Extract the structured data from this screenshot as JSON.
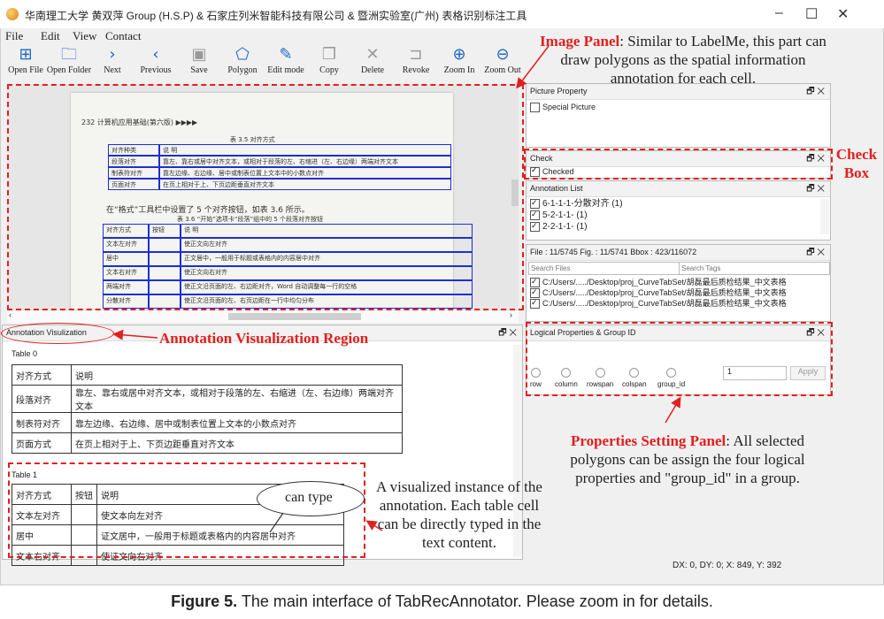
{
  "window": {
    "title": "华南理工大学 黄双萍 Group (H.S.P) & 石家庄列米智能科技有限公司 & 暨洲实验室(广州) 表格识别标注工具",
    "controls": {
      "minimize": "–",
      "maximize": "☐",
      "close": "✕"
    }
  },
  "menu": [
    "File",
    "Edit",
    "View",
    "Contact"
  ],
  "toolbar": [
    {
      "label": "Open File",
      "icon": "plus-file-icon",
      "glyph": "⊞"
    },
    {
      "label": "Open Folder",
      "icon": "folder-icon",
      "glyph": "🗀"
    },
    {
      "label": "Next",
      "icon": "chevron-right-icon",
      "glyph": "›"
    },
    {
      "label": "Previous",
      "icon": "chevron-left-icon",
      "glyph": "‹"
    },
    {
      "label": "Save",
      "icon": "save-icon",
      "glyph": "▣"
    },
    {
      "label": "Polygon",
      "icon": "polygon-icon",
      "glyph": "⬠"
    },
    {
      "label": "Edit mode",
      "icon": "edit-icon",
      "glyph": "✎"
    },
    {
      "label": "Copy",
      "icon": "copy-icon",
      "glyph": "❐"
    },
    {
      "label": "Delete",
      "icon": "delete-icon",
      "glyph": "✕"
    },
    {
      "label": "Revoke",
      "icon": "revoke-icon",
      "glyph": "⊐"
    },
    {
      "label": "Zoom In",
      "icon": "zoom-in-icon",
      "glyph": "⊕"
    },
    {
      "label": "Zoom Out",
      "icon": "zoom-out-icon",
      "glyph": "⊖"
    }
  ],
  "image_panel": {
    "page_header": "232  计算机应用基础(第六版)  ▶▶▶▶",
    "table1_caption": "表 3.5  对齐方式",
    "table1_rows": [
      [
        "对齐种类",
        "说    明"
      ],
      [
        "段落对齐",
        "靠左、靠右或居中对齐文本，或相对于段落的左、右缩进（左、右边缘）两端对齐文本"
      ],
      [
        "制表符对齐",
        "靠左边缘、右边缘、居中或制表位置上文本中的小数点对齐"
      ],
      [
        "页面对齐",
        "在页上相对于上、下页边距垂直对齐文本"
      ]
    ],
    "para_text": "在“格式”工具栏中设置了 5 个对齐按钮，如表 3.6 所示。",
    "table2_caption": "表 3.6  “开始”选项卡“段落”组中的 5 个段落对齐按钮",
    "table2_rows": [
      [
        "对齐方式",
        "按钮",
        "说    明"
      ],
      [
        "文本左对齐",
        "",
        "使正文向左对齐"
      ],
      [
        "居中",
        "",
        "正文居中，一般用于标题或表格内的内容居中对齐"
      ],
      [
        "文本右对齐",
        "",
        "使正文向右对齐"
      ],
      [
        "两端对齐",
        "",
        "使正文沿页面的左、右边距对齐，Word 自动调整每一行的空格"
      ],
      [
        "分散对齐",
        "",
        "使正文沿页面的左、右页边距在一行中均匀分布"
      ]
    ]
  },
  "docks": {
    "picture_property": {
      "title": "Picture Property",
      "checkbox": "Special Picture",
      "checked": false
    },
    "check": {
      "title": "Check",
      "checkbox": "Checked",
      "checked": true
    },
    "annotation_list": {
      "title": "Annotation List",
      "items": [
        "6-1-1-1-分散对齐 (1)",
        "5-2-1-1- (1)",
        "2-2-1-1- (1)"
      ]
    },
    "file_info": {
      "title": "File : 11/5745  Fig. : 11/5741 Bbox : 423/116072",
      "search_files_placeholder": "Search Files",
      "search_tags_placeholder": "Search Tags",
      "files": [
        "C:/Users/...../Desktop/proj_CurveTabSet/胡磊最后质检结果_中文表格",
        "C:/Users/...../Desktop/proj_CurveTabSet/胡磊最后质检结果_中文表格",
        "C:/Users/...../Desktop/proj_CurveTabSet/胡磊最后质检结果_中文表格"
      ]
    },
    "logical": {
      "title": "Logical Properties & Group ID",
      "radios": [
        "row",
        "column",
        "rowspan",
        "colspan",
        "group_id"
      ],
      "value": "1",
      "apply": "Apply"
    },
    "visualization": {
      "title": "Annotation Visulization"
    }
  },
  "visualization": {
    "table0_label": "Table 0",
    "table0": [
      [
        "对齐方式",
        "说明"
      ],
      [
        "段落对齐",
        "靠左、靠右或居中对齐文本，或相对于段落的左、右缩进（左、右边缘）两端对齐文本"
      ],
      [
        "制表符对齐",
        "靠左边缘、右边缘、居中或制表位置上文本的小数点对齐"
      ],
      [
        "页面方式",
        "在页上相对于上、下页边距垂直对齐文本"
      ]
    ],
    "table1_label": "Table 1",
    "table1": [
      [
        "对齐方式",
        "按钮",
        "说明"
      ],
      [
        "文本左对齐",
        "",
        "使文本向左对齐"
      ],
      [
        "居中",
        "",
        "证文居中，一般用于标题或表格内的内容居中对齐"
      ],
      [
        "文本右对齐",
        "",
        "使证文向右对齐"
      ]
    ],
    "callout_text": "can type"
  },
  "status": "DX:  0,  DY:  0;    X:  849,  Y:  392",
  "annotations": {
    "image_panel_title": "Image Panel",
    "image_panel_desc": ": Similar to LabelMe, this part can draw polygons as the spatial information annotation for each cell.",
    "check_box": "Check Box",
    "vis_region": "Annotation Visualization Region",
    "props_title": "Properties Setting Panel",
    "props_desc": ": All selected polygons can be assign the four logical properties and \"group_id\" in a group.",
    "instance_desc": "A visualized instance of the annotation. Each table cell can be directly typed in the text content."
  },
  "caption_label": "Figure 5.",
  "caption_text": " The main interface of TabRecAnnotator. Please zoom in for details.",
  "colors": {
    "accent": "#1f66c5",
    "annotation_red": "#e02020",
    "polygon_blue": "#1d2fd6"
  }
}
